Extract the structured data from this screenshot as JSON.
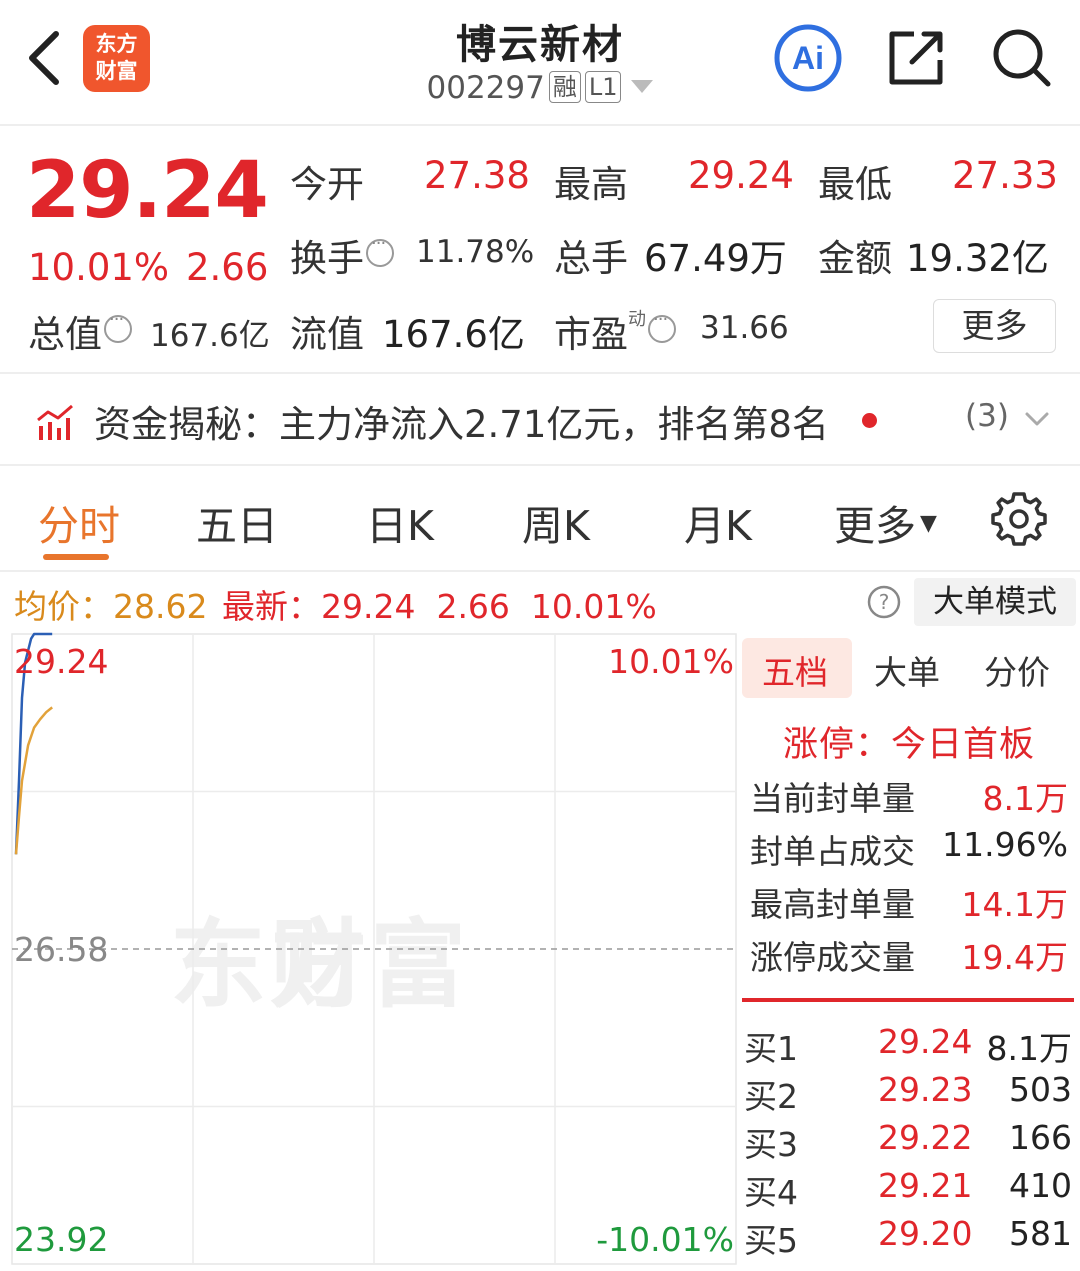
{
  "header": {
    "logo_line1": "东方",
    "logo_line2": "财富",
    "title": "博云新材",
    "code": "002297",
    "tag_margin": "融",
    "tag_level": "L1"
  },
  "quote": {
    "price": "29.24",
    "pct": "10.01%",
    "change": "2.66",
    "fields": {
      "open_label": "今开",
      "open": "27.38",
      "high_label": "最高",
      "high": "29.24",
      "low_label": "最低",
      "low": "27.33",
      "turnover_label": "换手",
      "turnover": "11.78%",
      "volume_label": "总手",
      "volume": "67.49万",
      "amount_label": "金额",
      "amount": "19.32亿",
      "mktcap_label": "总值",
      "mktcap": "167.6亿",
      "float_label": "流值",
      "float": "167.6亿",
      "pe_label": "市盈",
      "pe_sup": "动",
      "pe": "31.66"
    },
    "more_label": "更多"
  },
  "fund_flow": {
    "text": "资金揭秘：主力净流入2.71亿元，排名第8名",
    "count": "(3)"
  },
  "tabs": [
    "分时",
    "五日",
    "日K",
    "周K",
    "月K",
    "更多"
  ],
  "info_line": {
    "avg": "均价：28.62",
    "latest": "最新：29.24  2.66  10.01%",
    "big_order_mode": "大单模式"
  },
  "chart_data": {
    "type": "line",
    "y_labels": {
      "top": "29.24",
      "mid": "26.58",
      "bottom": "23.92"
    },
    "pct_labels": {
      "top": "10.01%",
      "bottom": "-10.01%"
    },
    "ylim": [
      23.92,
      29.24
    ],
    "prev_close": 26.58,
    "series": [
      {
        "key": "price",
        "color": "#2b5fb5",
        "x": [
          0,
          1,
          2,
          3,
          4,
          5,
          6,
          7,
          8,
          10,
          12
        ],
        "values": [
          27.38,
          28.0,
          28.7,
          29.0,
          29.1,
          29.2,
          29.24,
          29.24,
          29.24,
          29.24,
          29.24
        ]
      },
      {
        "key": "average",
        "color": "#e2a23a",
        "x": [
          0,
          1,
          2,
          4,
          6,
          8,
          10,
          12
        ],
        "values": [
          27.38,
          27.7,
          28.0,
          28.3,
          28.45,
          28.52,
          28.58,
          28.62
        ]
      }
    ],
    "x_total": 240
  },
  "panel": {
    "tabs": [
      "五档",
      "大单",
      "分价"
    ],
    "limit_title": "涨停：今日首板",
    "stats": [
      {
        "label": "当前封单量",
        "value": "8.1万"
      },
      {
        "label": "封单占成交",
        "value": "11.96%"
      },
      {
        "label": "最高封单量",
        "value": "14.1万"
      },
      {
        "label": "涨停成交量",
        "value": "19.4万"
      }
    ],
    "bids": [
      {
        "label": "买1",
        "price": "29.24",
        "qty": "8.1万"
      },
      {
        "label": "买2",
        "price": "29.23",
        "qty": "503"
      },
      {
        "label": "买3",
        "price": "29.22",
        "qty": "166"
      },
      {
        "label": "买4",
        "price": "29.21",
        "qty": "410"
      },
      {
        "label": "买5",
        "price": "29.20",
        "qty": "581"
      }
    ]
  }
}
